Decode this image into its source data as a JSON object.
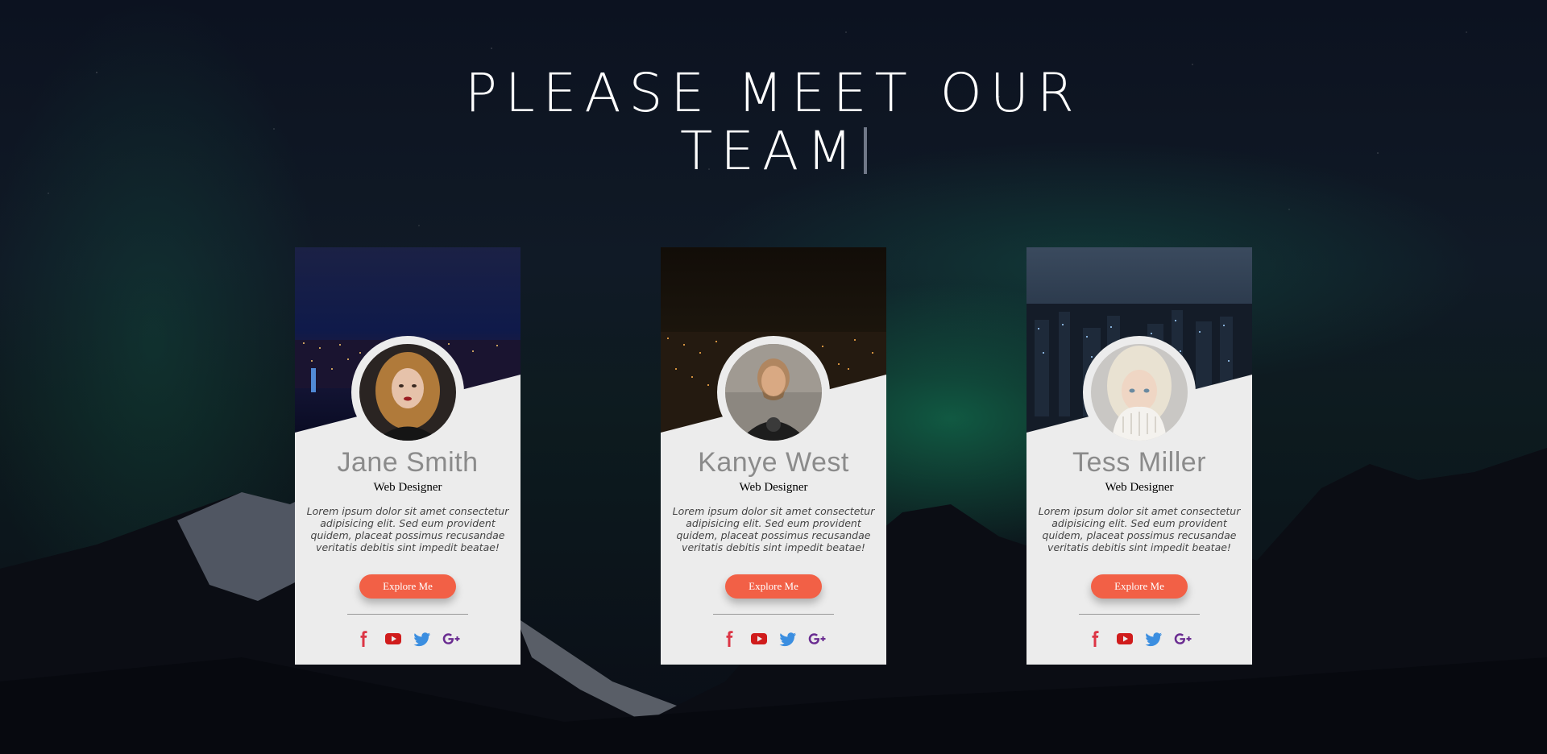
{
  "heading": {
    "line1": "PLEASE MEET OUR",
    "line2": "TEAM"
  },
  "colors": {
    "accent": "#f26046",
    "card_bg": "#ececec",
    "facebook": "#dc3545",
    "youtube": "#d01c1c",
    "twitter": "#3b8ee0",
    "google_plus": "#6a2c91"
  },
  "team": [
    {
      "name": "Jane Smith",
      "role": "Web Designer",
      "bio": "Lorem ipsum dolor sit amet consectetur adipisicing elit. Sed eum provident quidem, placeat possimus recusandae veritatis debitis sint impedit beatae!",
      "button": "Explore Me",
      "icons": [
        "facebook-icon",
        "youtube-icon",
        "twitter-icon",
        "google-plus-icon"
      ]
    },
    {
      "name": "Kanye West",
      "role": "Web Designer",
      "bio": "Lorem ipsum dolor sit amet consectetur adipisicing elit. Sed eum provident quidem, placeat possimus recusandae veritatis debitis sint impedit beatae!",
      "button": "Explore Me",
      "icons": [
        "facebook-icon",
        "youtube-icon",
        "twitter-icon",
        "google-plus-icon"
      ]
    },
    {
      "name": "Tess Miller",
      "role": "Web Designer",
      "bio": "Lorem ipsum dolor sit amet consectetur adipisicing elit. Sed eum provident quidem, placeat possimus recusandae veritatis debitis sint impedit beatae!",
      "button": "Explore Me",
      "icons": [
        "facebook-icon",
        "youtube-icon",
        "twitter-icon",
        "google-plus-icon"
      ]
    }
  ]
}
